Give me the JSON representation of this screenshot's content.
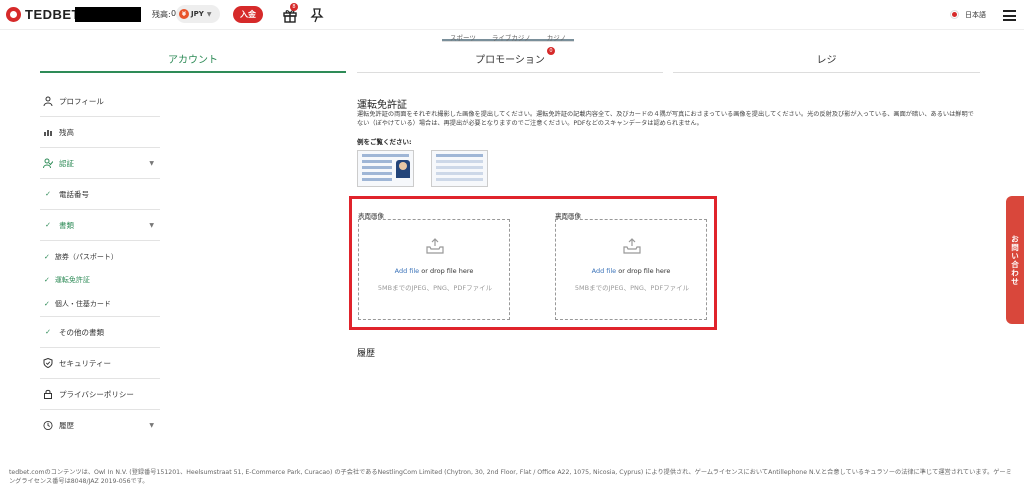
{
  "header": {
    "logo_text": "TEDBET",
    "balance_label": "残高:",
    "balance_value": "0",
    "currency": "JPY",
    "currency_symbol": "¥",
    "deposit_label": "入金",
    "gift_badge": "8",
    "language": "日本語"
  },
  "subnav": [
    "スポーツ",
    "ライブカジノ",
    "カジノ"
  ],
  "tabs": {
    "account": "アカウント",
    "promotion": "プロモーション",
    "promotion_badge": "0",
    "cashier": "レジ"
  },
  "sidebar": {
    "profile": "プロフィール",
    "balance": "残高",
    "verification": "認証",
    "phone": "電話番号",
    "documents": "書類",
    "passport": "旅券（パスポート）",
    "license": "運転免許証",
    "id_address": "個人・住基カード",
    "other_docs": "その他の書類",
    "security": "セキュリティー",
    "privacy": "プライバシーポリシー",
    "history": "履歴"
  },
  "content": {
    "title": "運転免許証",
    "description": "運転免許証の両面をそれぞれ撮影した画像を提出してください。運転免許証の記載内容全て、及びカードの４隅が写真におさまっている画像を提出してください。光の反射及び影が入っている、画面が暗い、あるいは鮮明でない（ぼやけている）場合は、再提出が必要となりますのでご注意ください。PDFなどのスキャンデータは認められません。",
    "example_label": "例をご覧ください:",
    "front_label": "表面画像",
    "back_label": "裏面画像",
    "add_file": "Add file",
    "drop_text": " or drop file here",
    "hint": "5MBまでのJPEG、PNG、PDFファイル",
    "history_title": "履歴"
  },
  "contact_label": "お問い合わせ",
  "footer_text": "tedbet.comのコンテンツは、Owl In N.V. (登録番号151201、Heelsumstraat 51, E-Commerce Park, Curacao) の子会社であるNestlingCom Limited (Chytron, 30, 2nd Floor, Flat / Office A22, 1075, Nicosia, Cyprus) により提供され、ゲームライセンスにおいてAntillephone N.V.と合意しているキュラソーの法律に準じて運営されています。ゲーミングライセンス番号は8048/JAZ 2019-056です。",
  "colors": {
    "brand_red": "#d62a2a",
    "accent_green": "#2e8b57",
    "highlight_red": "#e0232b",
    "link_blue": "#3b73b9"
  }
}
